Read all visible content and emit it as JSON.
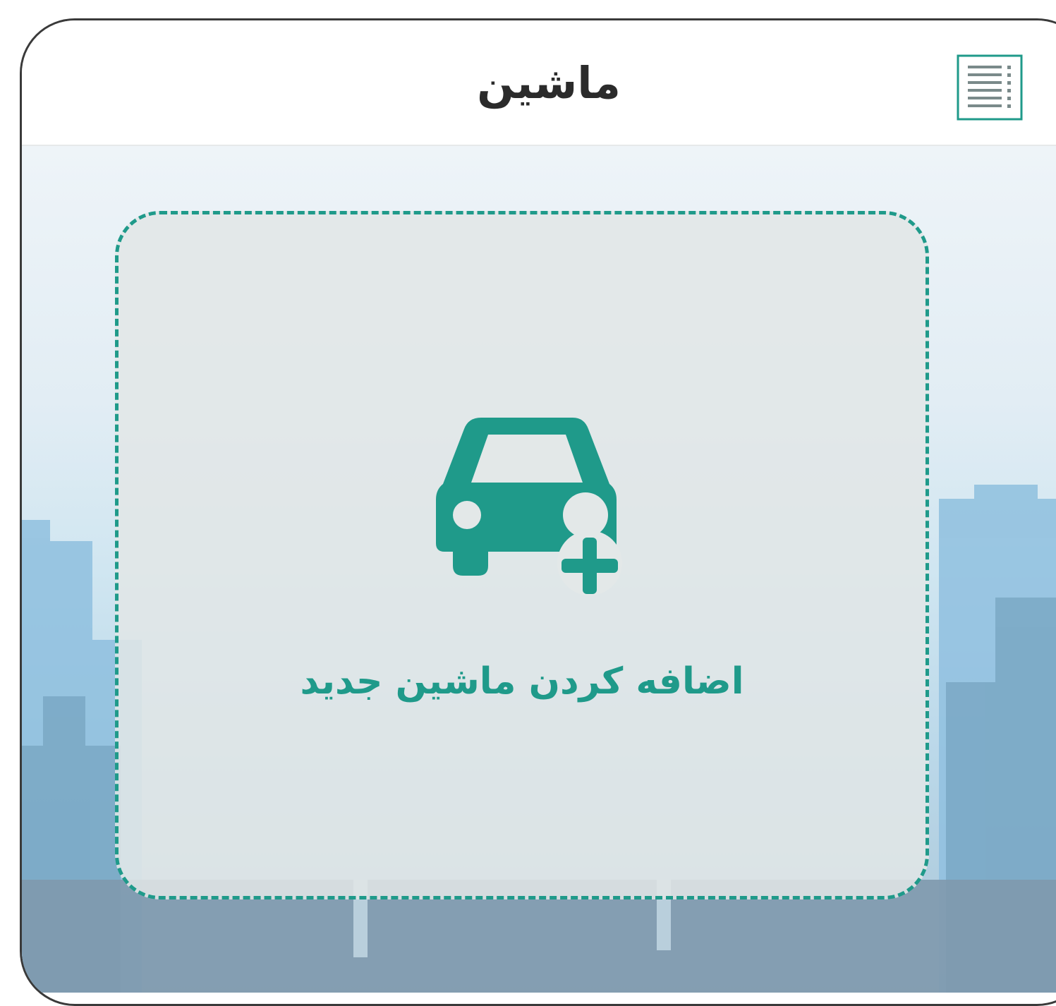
{
  "header": {
    "title": "ماشین",
    "menu_icon": "list-menu-icon"
  },
  "main": {
    "add_car": {
      "label": "اضافه کردن ماشین جدید",
      "icon": "car-add-icon"
    }
  },
  "colors": {
    "accent": "#1f9a8a",
    "title_text": "#2b2b2b",
    "header_bg": "#ffffff",
    "card_bg": "#e2e6e6"
  }
}
